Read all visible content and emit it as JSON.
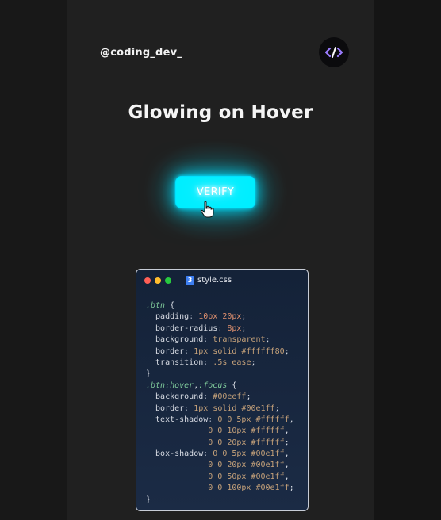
{
  "header": {
    "handle": "@coding_dev_",
    "logo_icon": "code-brackets-icon"
  },
  "hero": {
    "title": "Glowing on Hover",
    "button_label": "VERIFY"
  },
  "colors": {
    "accent": "#00eeff",
    "glow": "#00e1ff"
  },
  "editor": {
    "file_badge": "3",
    "file_name": "style.css",
    "lines": [
      [
        {
          "t": ".btn",
          "c": "sel"
        },
        {
          "t": " {",
          "c": "punc"
        }
      ],
      [
        {
          "t": "  padding",
          "c": "prop"
        },
        {
          "t": ": ",
          "c": "col"
        },
        {
          "t": "10px 20px",
          "c": "num"
        },
        {
          "t": ";",
          "c": "punc"
        }
      ],
      [
        {
          "t": "  border-radius",
          "c": "prop"
        },
        {
          "t": ": ",
          "c": "col"
        },
        {
          "t": "8px",
          "c": "num"
        },
        {
          "t": ";",
          "c": "punc"
        }
      ],
      [
        {
          "t": "  background",
          "c": "prop"
        },
        {
          "t": ": ",
          "c": "col"
        },
        {
          "t": "transparent",
          "c": "val"
        },
        {
          "t": ";",
          "c": "punc"
        }
      ],
      [
        {
          "t": "  border",
          "c": "prop"
        },
        {
          "t": ": ",
          "c": "col"
        },
        {
          "t": "1px solid #ffffff80",
          "c": "val"
        },
        {
          "t": ";",
          "c": "punc"
        }
      ],
      [
        {
          "t": "  transition",
          "c": "prop"
        },
        {
          "t": ": ",
          "c": "col"
        },
        {
          "t": ".5s ease",
          "c": "val"
        },
        {
          "t": ";",
          "c": "punc"
        }
      ],
      [
        {
          "t": "}",
          "c": "punc"
        }
      ],
      [
        {
          "t": ".btn:hover",
          "c": "sel"
        },
        {
          "t": ",",
          "c": "punc"
        },
        {
          "t": ":focus",
          "c": "sel"
        },
        {
          "t": " {",
          "c": "punc"
        }
      ],
      [
        {
          "t": "  background",
          "c": "prop"
        },
        {
          "t": ": ",
          "c": "col"
        },
        {
          "t": "#00eeff",
          "c": "val"
        },
        {
          "t": ";",
          "c": "punc"
        }
      ],
      [
        {
          "t": "  border",
          "c": "prop"
        },
        {
          "t": ": ",
          "c": "col"
        },
        {
          "t": "1px solid #00e1ff",
          "c": "val"
        },
        {
          "t": ";",
          "c": "punc"
        }
      ],
      [
        {
          "t": "  text-shadow",
          "c": "prop"
        },
        {
          "t": ": ",
          "c": "col"
        },
        {
          "t": "0 0 5px #ffffff",
          "c": "val"
        },
        {
          "t": ",",
          "c": "punc"
        }
      ],
      [
        {
          "t": "             0 0 10px #ffffff",
          "c": "val"
        },
        {
          "t": ",",
          "c": "punc"
        }
      ],
      [
        {
          "t": "             0 0 20px #ffffff",
          "c": "val"
        },
        {
          "t": ";",
          "c": "punc"
        }
      ],
      [
        {
          "t": "  box-shadow",
          "c": "prop"
        },
        {
          "t": ": ",
          "c": "col"
        },
        {
          "t": "0 0 5px #00e1ff",
          "c": "val"
        },
        {
          "t": ",",
          "c": "punc"
        }
      ],
      [
        {
          "t": "             0 0 20px #00e1ff",
          "c": "val"
        },
        {
          "t": ",",
          "c": "punc"
        }
      ],
      [
        {
          "t": "             0 0 50px #00e1ff",
          "c": "val"
        },
        {
          "t": ",",
          "c": "punc"
        }
      ],
      [
        {
          "t": "             0 0 100px #00e1ff",
          "c": "val"
        },
        {
          "t": ";",
          "c": "punc"
        }
      ],
      [
        {
          "t": "}",
          "c": "punc"
        }
      ]
    ]
  }
}
